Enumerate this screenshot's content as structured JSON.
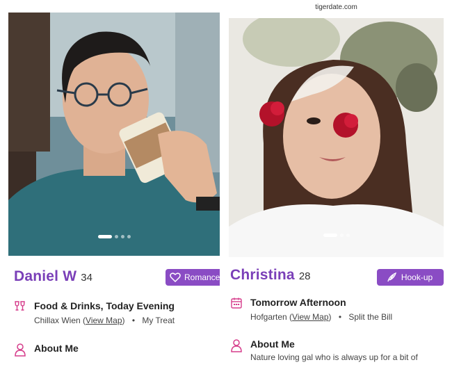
{
  "colors": {
    "accent": "#7a3fb8",
    "tag_bg": "#8a4cc4",
    "icon_pink": "#d63d8b"
  },
  "profiles": [
    {
      "name": "Daniel W",
      "age": "34",
      "tag": "Romance",
      "tag_icon": "heart-icon",
      "date_icon": "wine-glasses-icon",
      "date_title": "Food & Drinks, Today Evening",
      "venue": "Chillax Wien",
      "venue_link_open": "(",
      "venue_link": "View Map",
      "venue_link_close": ")",
      "separator": "•",
      "payment": "My Treat",
      "about_icon": "person-icon",
      "about_title": "About Me",
      "photo_dots": {
        "count": 4,
        "active": 1
      }
    },
    {
      "name": "Christina",
      "age": "28",
      "url": "tigerdate.com",
      "tag": "Hook-up",
      "tag_icon": "feather-icon",
      "date_icon": "calendar-icon",
      "date_title": "Tomorrow Afternoon",
      "venue": "Hofgarten",
      "venue_link_open": "(",
      "venue_link": "View Map",
      "venue_link_close": ")",
      "separator": "•",
      "payment": "Split the Bill",
      "about_icon": "person-icon",
      "about_title": "About Me",
      "about_text": "Nature loving gal who is always up for a bit of",
      "photo_dots": {
        "count": 3,
        "active": 1
      }
    }
  ]
}
